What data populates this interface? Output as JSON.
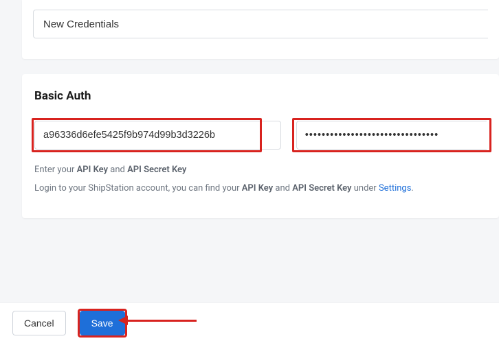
{
  "credentialName": {
    "value": "New Credentials"
  },
  "basicAuth": {
    "title": "Basic Auth",
    "apiKey": "a96336d6efe5425f9b974d99b3d3226b",
    "apiSecret": "••••••••••••••••••••••••••••••••",
    "help1_prefix": "Enter your ",
    "help1_b1": "API Key",
    "help1_mid": " and ",
    "help1_b2": "API Secret Key",
    "help2_prefix": "Login to your ShipStation account, you can find your ",
    "help2_b1": "API Key",
    "help2_mid": " and ",
    "help2_b2": "API Secret Key",
    "help2_suffix": " under ",
    "help2_link": "Settings",
    "help2_end": "."
  },
  "footer": {
    "cancel": "Cancel",
    "save": "Save"
  },
  "annotationColor": "#d8231f"
}
